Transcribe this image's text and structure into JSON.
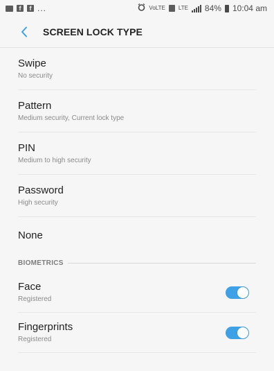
{
  "status_bar": {
    "left_dots": "...",
    "fb_letter_1": "f",
    "fb_letter_2": "f",
    "volte": "VoLTE",
    "lte": "LTE",
    "battery_percent": "84%",
    "time": "10:04 am"
  },
  "header": {
    "title": "SCREEN LOCK TYPE",
    "back_icon": "chevron-left-icon"
  },
  "lock_types": [
    {
      "title": "Swipe",
      "subtitle": "No security"
    },
    {
      "title": "Pattern",
      "subtitle": "Medium security, Current lock type"
    },
    {
      "title": "PIN",
      "subtitle": "Medium to high security"
    },
    {
      "title": "Password",
      "subtitle": "High security"
    },
    {
      "title": "None"
    }
  ],
  "biometrics": {
    "section_label": "BIOMETRICS",
    "items": [
      {
        "title": "Face",
        "subtitle": "Registered",
        "enabled": true
      },
      {
        "title": "Fingerprints",
        "subtitle": "Registered",
        "enabled": true
      }
    ]
  },
  "colors": {
    "accent": "#3ea1e6",
    "background": "#f6f6f6"
  }
}
